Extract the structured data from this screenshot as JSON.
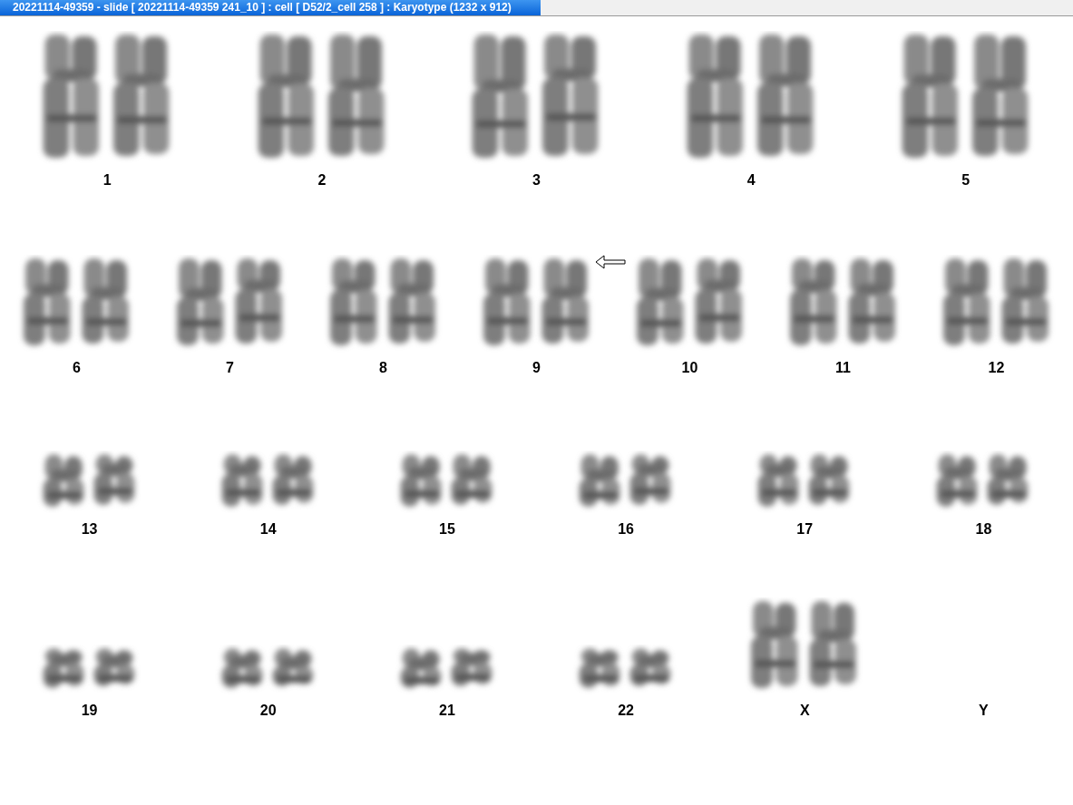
{
  "window": {
    "title": "20221114-49359 - slide [ 20221114-49359 241_10 ] : cell [ D52/2_cell 258 ] : Karyotype  (1232 x 912)"
  },
  "karyotype": {
    "rows": [
      {
        "pairs": [
          {
            "label": "1",
            "kind": "large",
            "marked": false
          },
          {
            "label": "2",
            "kind": "large",
            "marked": false
          },
          {
            "label": "3",
            "kind": "large",
            "marked": false
          },
          {
            "label": "4",
            "kind": "large",
            "marked": false
          },
          {
            "label": "5",
            "kind": "large",
            "marked": false
          }
        ]
      },
      {
        "pairs": [
          {
            "label": "6",
            "kind": "medium",
            "marked": false
          },
          {
            "label": "7",
            "kind": "medium",
            "marked": false
          },
          {
            "label": "8",
            "kind": "medium",
            "marked": false
          },
          {
            "label": "9",
            "kind": "medium",
            "marked": true
          },
          {
            "label": "10",
            "kind": "medium",
            "marked": false
          },
          {
            "label": "11",
            "kind": "medium",
            "marked": false
          },
          {
            "label": "12",
            "kind": "medium",
            "marked": false
          }
        ]
      },
      {
        "pairs": [
          {
            "label": "13",
            "kind": "small",
            "marked": false
          },
          {
            "label": "14",
            "kind": "small",
            "marked": false
          },
          {
            "label": "15",
            "kind": "small",
            "marked": false
          },
          {
            "label": "16",
            "kind": "small",
            "marked": false
          },
          {
            "label": "17",
            "kind": "small",
            "marked": false
          },
          {
            "label": "18",
            "kind": "small",
            "marked": false
          }
        ]
      },
      {
        "pairs": [
          {
            "label": "19",
            "kind": "tiny",
            "marked": false
          },
          {
            "label": "20",
            "kind": "tiny",
            "marked": false
          },
          {
            "label": "21",
            "kind": "tiny",
            "marked": false
          },
          {
            "label": "22",
            "kind": "tiny",
            "marked": false
          },
          {
            "label": "X",
            "kind": "medium",
            "marked": false
          },
          {
            "label": "Y",
            "kind": "none",
            "marked": false
          }
        ]
      }
    ]
  }
}
